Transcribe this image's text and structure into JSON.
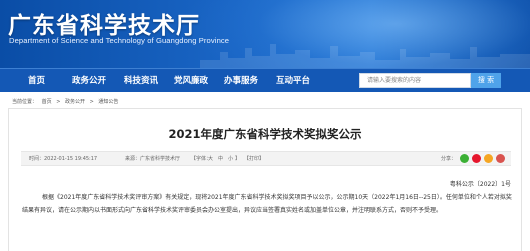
{
  "header": {
    "title": "广东省科学技术厅",
    "subtitle": "Department of Science and Technology of Guangdong Province"
  },
  "nav": {
    "items": [
      {
        "label": "首页"
      },
      {
        "label": "政务公开"
      },
      {
        "label": "科技资讯"
      },
      {
        "label": "党风廉政"
      },
      {
        "label": "办事服务"
      },
      {
        "label": "互动平台"
      }
    ],
    "search_placeholder": "请输入要搜索的内容",
    "search_button": "搜 索"
  },
  "breadcrumb": {
    "prefix": "当前位置：",
    "items": [
      "首页",
      "政务公开",
      "通知公告"
    ],
    "separator": ">"
  },
  "article": {
    "title": "2021年度广东省科学技术奖拟奖公示",
    "time": "时间：2022-01-15 19:45:17",
    "source": "来源：广东省科学技术厅",
    "font_size_label": "【字体：",
    "font_large": "大",
    "font_medium": "中",
    "font_small": "小",
    "font_close": "】",
    "print": "【打印】",
    "share_label": "分享：",
    "doc_number": "粤科公示〔2022〕1号",
    "body": "根据《2021年度广东省科学技术奖评审方案》有关规定，现将2021年度广东省科学技术奖拟奖项目予以公示，公示期10天（2022年1月16日--25日）。任何单位和个人若对拟奖结果有异议，请在公示期内以书面形式向广东省科学技术奖评审委员会办公室提出，异议应当签署真实姓名或加盖单位公章，并注明联系方式，否则不予受理。"
  },
  "colors": {
    "banner": "#1a66c6",
    "nav": "#1458b5",
    "search_button": "#4fa3ea",
    "share_wechat": "#3cb035",
    "share_weibo": "#e6162d",
    "share_qzone": "#f5a623",
    "share_more": "#d9534f"
  }
}
